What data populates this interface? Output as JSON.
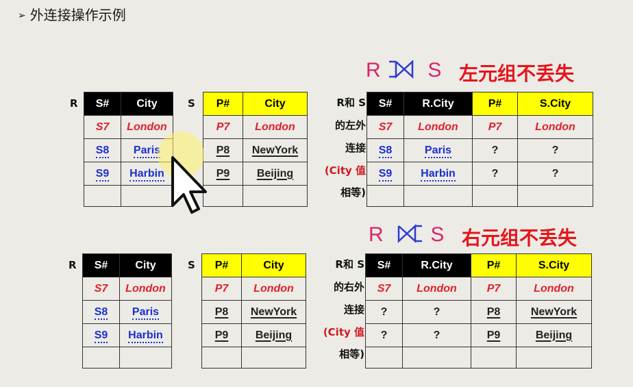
{
  "title": "外连接操作示例",
  "left_join": {
    "op_left": "R",
    "op_right": "S",
    "heading": "左元组不丢失",
    "r_label": "R",
    "r_header": [
      "S#",
      "City"
    ],
    "r_rows": [
      [
        "S7",
        "London"
      ],
      [
        "S8",
        "Paris"
      ],
      [
        "S9",
        "Harbin"
      ]
    ],
    "s_label": "S",
    "s_header": [
      "P#",
      "City"
    ],
    "s_rows": [
      [
        "P7",
        "London"
      ],
      [
        "P8",
        "NewYork"
      ],
      [
        "P9",
        "Beijing"
      ]
    ],
    "note": [
      "R和 S",
      "的左外",
      "连接",
      "(City 值",
      "相等)"
    ],
    "result_header": [
      "S#",
      "R.City",
      "P#",
      "S.City"
    ],
    "result_rows": [
      [
        "S7",
        "London",
        "P7",
        "London"
      ],
      [
        "S8",
        "Paris",
        "?",
        "?"
      ],
      [
        "S9",
        "Harbin",
        "?",
        "?"
      ]
    ]
  },
  "right_join": {
    "op_left": "R",
    "op_right": "S",
    "heading": "右元组不丢失",
    "r_label": "R",
    "r_header": [
      "S#",
      "City"
    ],
    "r_rows": [
      [
        "S7",
        "London"
      ],
      [
        "S8",
        "Paris"
      ],
      [
        "S9",
        "Harbin"
      ]
    ],
    "s_label": "S",
    "s_header": [
      "P#",
      "City"
    ],
    "s_rows": [
      [
        "P7",
        "London"
      ],
      [
        "P8",
        "NewYork"
      ],
      [
        "P9",
        "Beijing"
      ]
    ],
    "note": [
      "R和 S",
      "的右外",
      "连接",
      "(City 值",
      "相等)"
    ],
    "result_header": [
      "S#",
      "R.City",
      "P#",
      "S.City"
    ],
    "result_rows": [
      [
        "S7",
        "London",
        "P7",
        "London"
      ],
      [
        "?",
        "?",
        "P8",
        "NewYork"
      ],
      [
        "?",
        "?",
        "P9",
        "Beijing"
      ]
    ]
  },
  "colors": {
    "header_black": "#000000",
    "header_yellow": "#ffff00",
    "matched_red": "#e0202a",
    "unmatched_blue": "#1a2fd0",
    "heading_red": "#e5151b",
    "operator_pink": "#d8256a"
  }
}
